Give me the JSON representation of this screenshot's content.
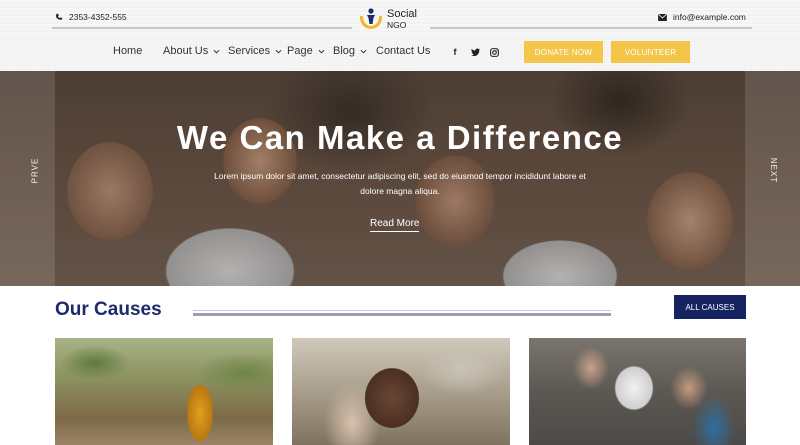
{
  "topbar": {
    "phone": "2353-4352-555",
    "email": "info@example.com",
    "logo_line1": "Social",
    "logo_line2": "NGO",
    "icons": [
      "phone-icon",
      "envelope-icon"
    ]
  },
  "nav": {
    "items": [
      {
        "label": "Home",
        "dropdown": false
      },
      {
        "label": "About Us",
        "dropdown": true
      },
      {
        "label": "Services",
        "dropdown": true
      },
      {
        "label": "Page",
        "dropdown": true
      },
      {
        "label": "Blog",
        "dropdown": true
      },
      {
        "label": "Contact Us",
        "dropdown": false
      }
    ],
    "social": [
      {
        "name": "facebook-icon",
        "glyph": "f"
      },
      {
        "name": "twitter-icon",
        "glyph": "t"
      },
      {
        "name": "instagram-icon",
        "glyph": "◎"
      }
    ],
    "donate_label": "DONATE NOW",
    "volunteer_label": "VOLUNTEER",
    "accent_color": "#f3c649"
  },
  "hero": {
    "title": "We Can Make a Difference",
    "text": "Lorem ipsum dolor sit amet, consectetur adipiscing elit, sed do eiusmod tempor incididunt labore et dolore magna aliqua.",
    "link_label": "Read More",
    "prev_label": "PRVE",
    "next_label": "NEXT"
  },
  "causes": {
    "title": "Our Causes",
    "all_label": "ALL CAUSES",
    "brand_color": "#152461",
    "cards": [
      {
        "image": "woman-carrying-water-photo"
      },
      {
        "image": "child-being-held-photo"
      },
      {
        "image": "group-of-children-photo"
      }
    ]
  }
}
